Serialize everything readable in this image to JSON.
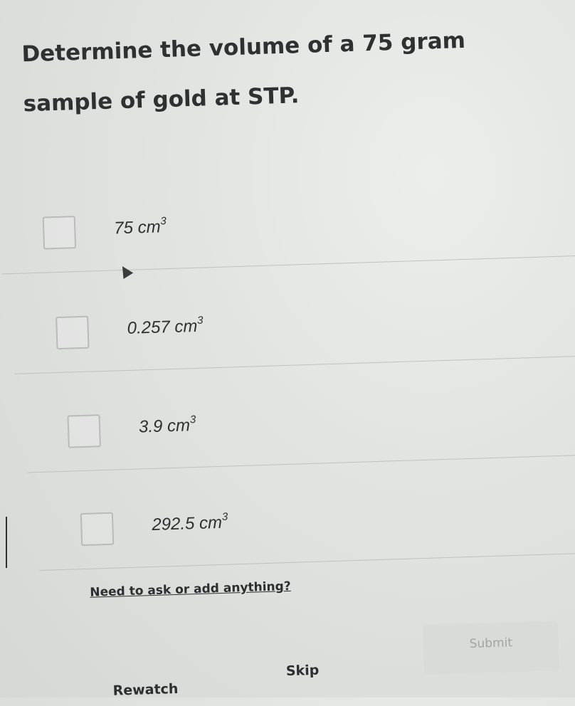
{
  "question": {
    "text": "Determine the volume of a 75 gram sample of gold at STP."
  },
  "options": [
    {
      "value": "75",
      "unit": "cm",
      "exponent": "3"
    },
    {
      "value": "0.257",
      "unit": "cm",
      "exponent": "3"
    },
    {
      "value": "3.9",
      "unit": "cm",
      "exponent": "3"
    },
    {
      "value": "292.5",
      "unit": "cm",
      "exponent": "3"
    }
  ],
  "links": {
    "ask": "Need to ask or add anything?"
  },
  "actions": {
    "rewatch": "Rewatch",
    "skip": "Skip",
    "submit": "Submit"
  }
}
